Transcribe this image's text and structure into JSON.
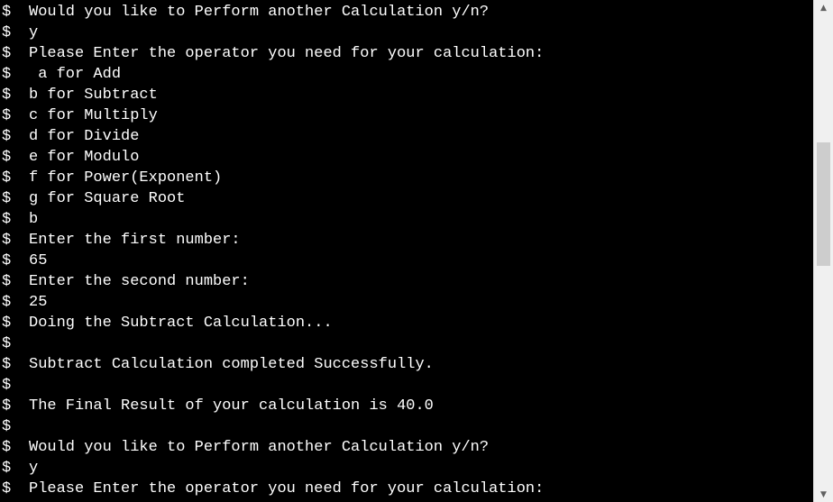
{
  "terminal": {
    "prompt": "$",
    "lines": [
      "Would you like to Perform another Calculation y/n?",
      "y",
      "Please Enter the operator you need for your calculation:",
      " a for Add",
      "b for Subtract",
      "c for Multiply",
      "d for Divide",
      "e for Modulo",
      "f for Power(Exponent)",
      "g for Square Root",
      "b",
      "Enter the first number:",
      "65",
      "Enter the second number:",
      "25",
      "Doing the Subtract Calculation...",
      "",
      "Subtract Calculation completed Successfully.",
      "",
      "The Final Result of your calculation is 40.0",
      "",
      "Would you like to Perform another Calculation y/n?",
      "y",
      "Please Enter the operator you need for your calculation:"
    ]
  },
  "scrollbar": {
    "up_icon": "▲",
    "down_icon": "▼",
    "position_fraction": 0.29
  },
  "colors": {
    "background": "#000000",
    "text": "#ffffff",
    "scrollbar_track": "#f0f0f0",
    "scrollbar_thumb": "#cdcdcd"
  }
}
